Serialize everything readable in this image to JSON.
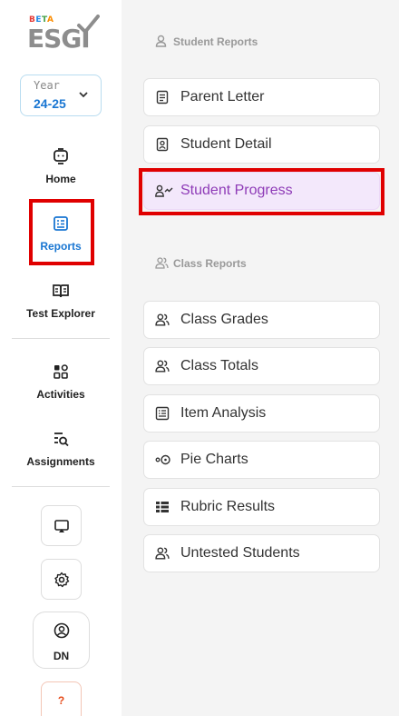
{
  "logo": {
    "beta_letters": [
      "B",
      "E",
      "T",
      "A"
    ],
    "word": "ESGI"
  },
  "year_select": {
    "label": "Year",
    "value": "24-25"
  },
  "nav": {
    "home": "Home",
    "reports": "Reports",
    "test_explorer": "Test Explorer",
    "activities": "Activities",
    "assignments": "Assignments"
  },
  "profile": {
    "initials": "DN"
  },
  "help": {
    "label": "?"
  },
  "student_reports": {
    "header": "Student Reports",
    "items": [
      "Parent Letter",
      "Student Detail",
      "Student Progress"
    ]
  },
  "class_reports": {
    "header": "Class Reports",
    "items": [
      "Class Grades",
      "Class Totals",
      "Item Analysis",
      "Pie Charts",
      "Rubric Results",
      "Untested Students"
    ]
  },
  "colors": {
    "accent": "#1976d2",
    "selected_text": "#8e3bb7",
    "selected_bg": "#f3e8fb",
    "highlight": "#e00000"
  }
}
